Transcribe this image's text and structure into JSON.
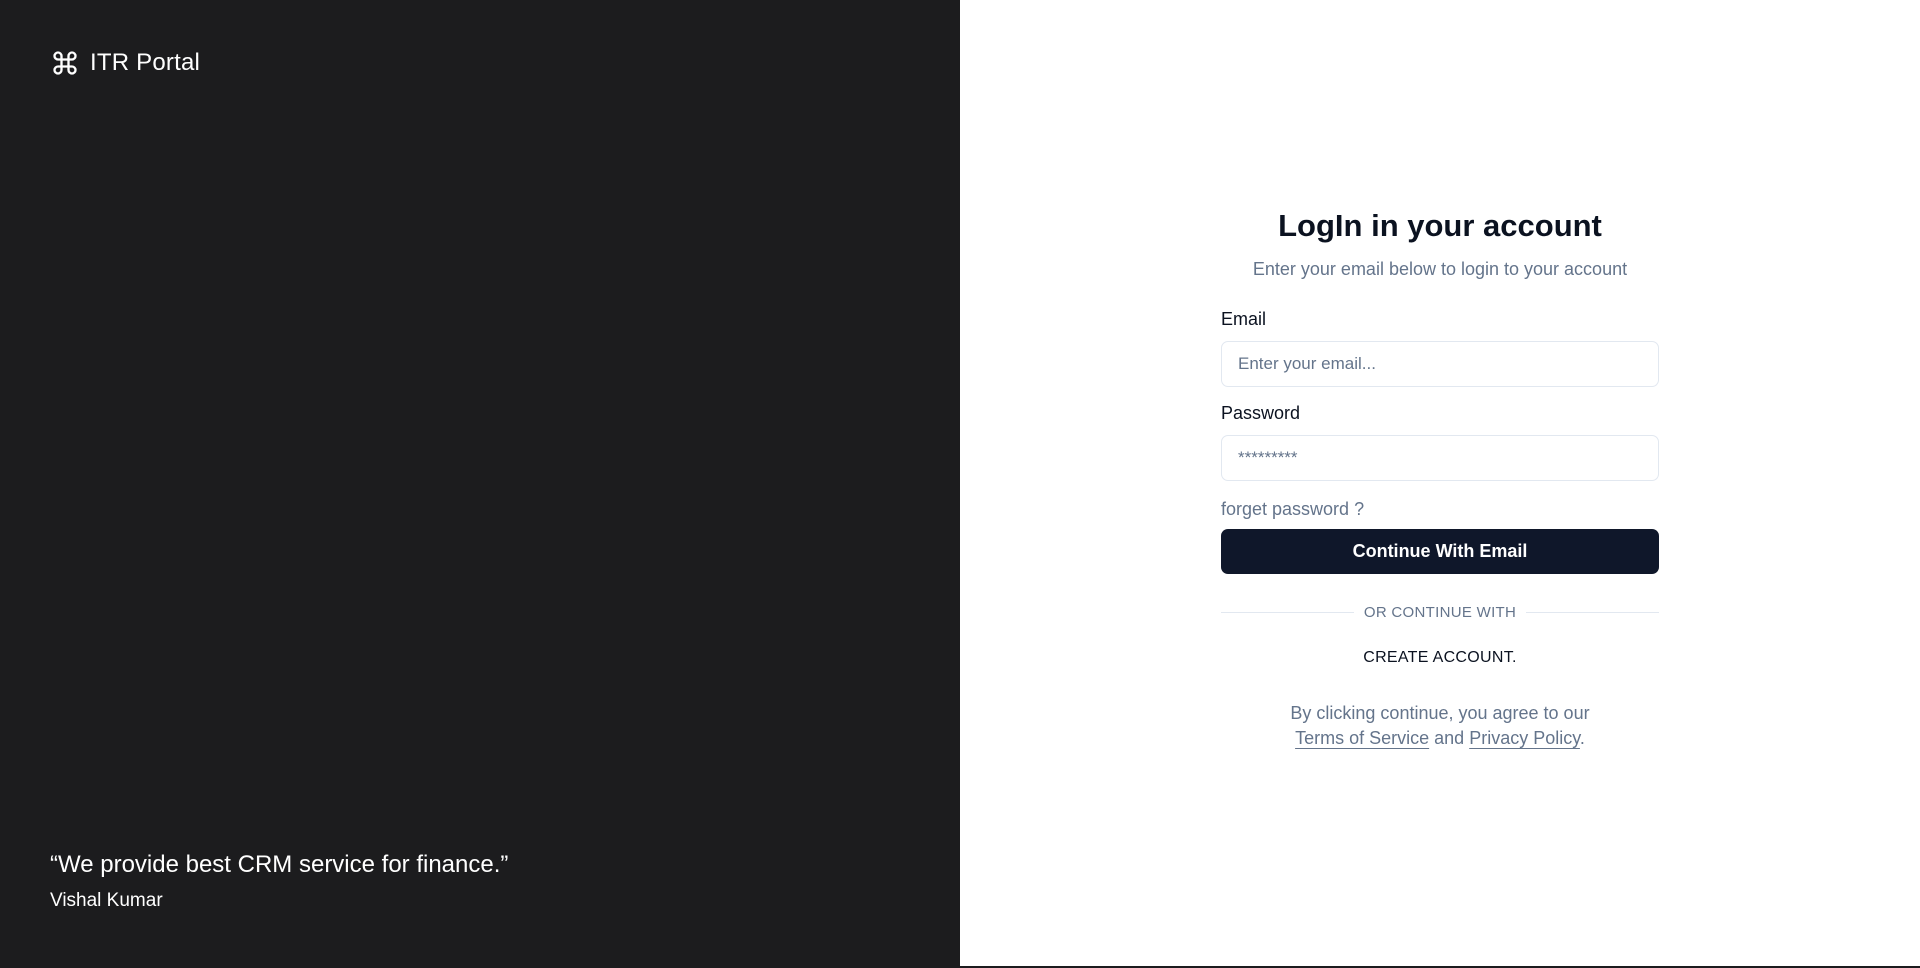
{
  "brand": {
    "icon": "command-icon",
    "name": "ITR Portal"
  },
  "testimonial": {
    "quote": "“We provide best CRM service for finance.”",
    "author": "Vishal Kumar"
  },
  "login": {
    "title": "LogIn in your account",
    "subtitle": "Enter your email below to login to your account",
    "email": {
      "label": "Email",
      "value": "",
      "placeholder": "Enter your email..."
    },
    "password": {
      "label": "Password",
      "value": "",
      "placeholder": "*********"
    },
    "forgot_label": "forget password ?",
    "submit_label": "Continue With Email",
    "divider_label": "OR CONTINUE WITH",
    "create_account_label": "CREATE ACCOUNT.",
    "legal": {
      "prefix": "By clicking continue, you agree to our",
      "terms": "Terms of Service",
      "and": "and",
      "privacy": "Privacy Policy",
      "suffix": "."
    }
  },
  "colors": {
    "left_panel_bg": "#1c1c1e",
    "primary_button_bg": "#0f172a",
    "muted_text": "#64748b"
  }
}
